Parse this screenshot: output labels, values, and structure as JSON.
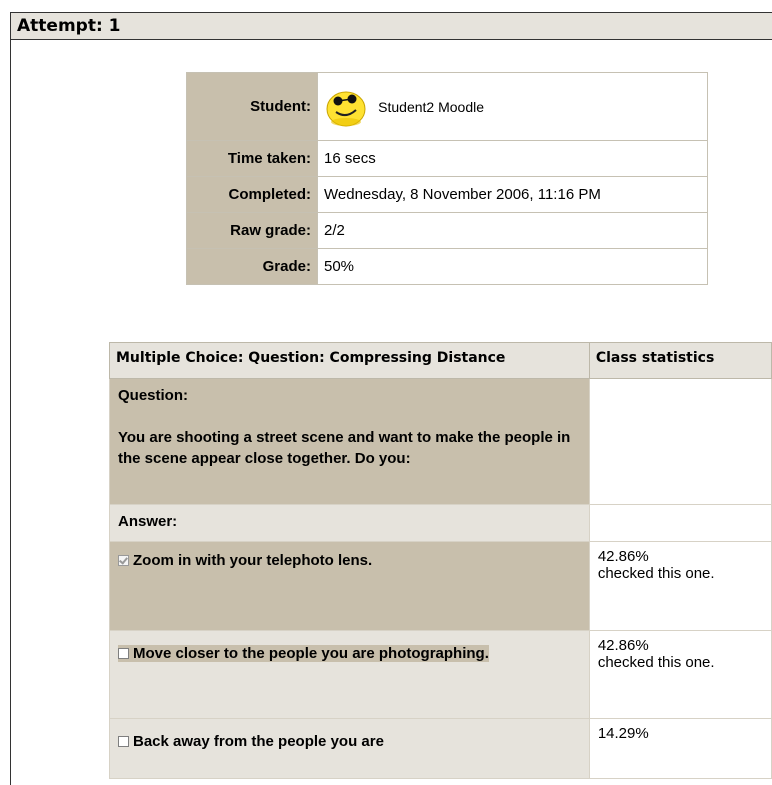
{
  "attempt": {
    "title": "Attempt: 1"
  },
  "summary": {
    "rows": [
      {
        "label": "Student:",
        "value": "Student2 Moodle"
      },
      {
        "label": "Time taken:",
        "value": "16 secs"
      },
      {
        "label": "Completed:",
        "value": "Wednesday, 8 November 2006, 11:16 PM"
      },
      {
        "label": "Raw grade:",
        "value": "2/2"
      },
      {
        "label": "Grade:",
        "value": "50%"
      }
    ],
    "avatar_icon": "smiley-sunglasses-icon"
  },
  "question": {
    "header": "Multiple Choice: Question: Compressing Distance",
    "stats_header": "Class statistics",
    "question_label": "Question:",
    "question_text": "You are shooting a street scene and want to make the people in the scene appear close together. Do you:",
    "answer_label": "Answer:",
    "options": [
      {
        "text": "Zoom in with your telephoto lens.",
        "checked": true,
        "stat_pct": "42.86%",
        "stat_text": "checked this one."
      },
      {
        "text": "Move closer to the people you are photographing.",
        "checked": false,
        "stat_pct": "42.86%",
        "stat_text": "checked this one."
      },
      {
        "text": "Back away from the people you are",
        "checked": false,
        "stat_pct": "14.29%",
        "stat_text": ""
      }
    ]
  },
  "colors": {
    "label_bg": "#c8bfac",
    "header_bg": "#e6e3dc",
    "border": "#c6c1b3"
  }
}
